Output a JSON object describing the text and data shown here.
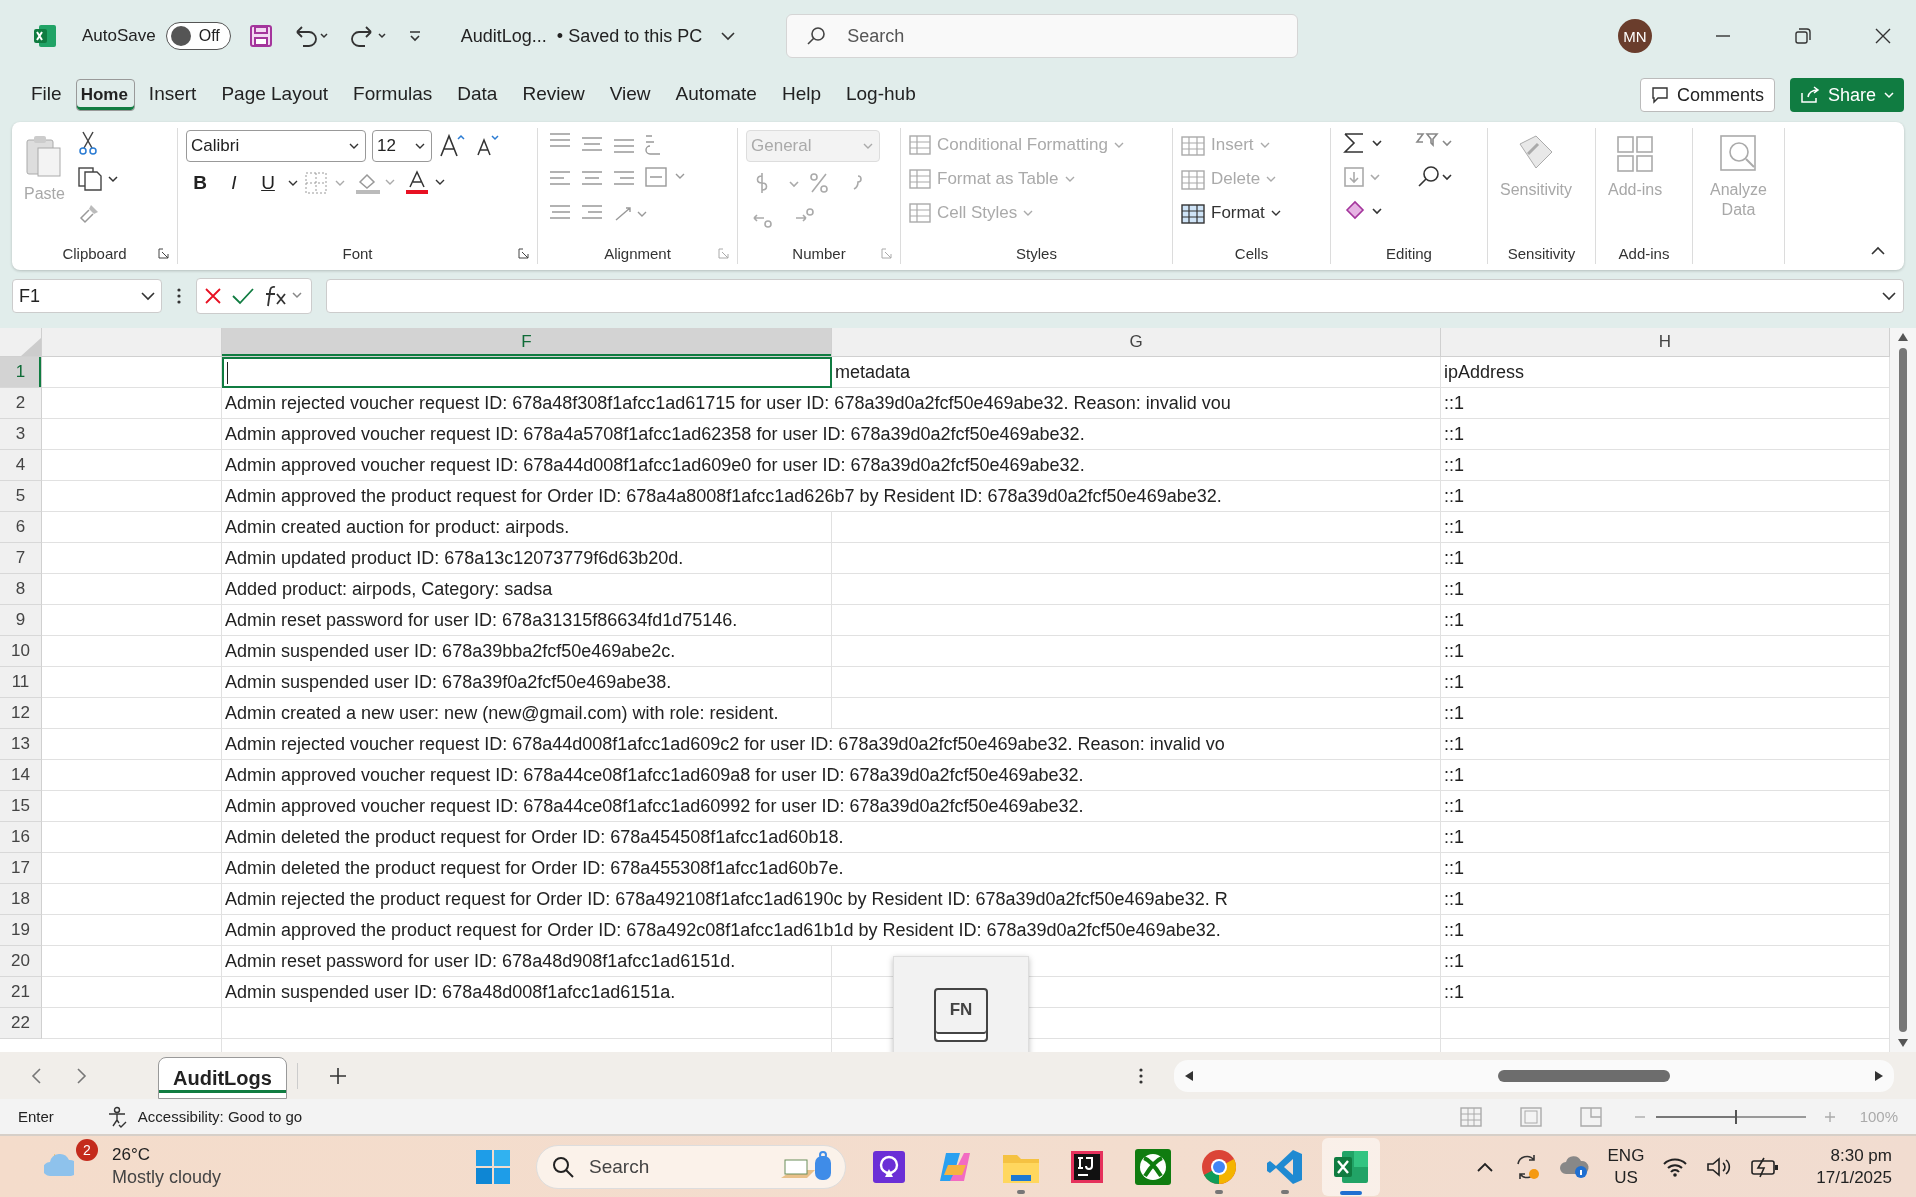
{
  "title_bar": {
    "autosave_label": "AutoSave",
    "autosave": {
      "on": false,
      "label": "Off"
    },
    "file_name": "AuditLog...",
    "save_status": "• Saved to this PC",
    "search_placeholder": "Search",
    "avatar": "MN"
  },
  "menu_tabs": [
    {
      "label": "File",
      "selected": false
    },
    {
      "label": "Home",
      "selected": true
    },
    {
      "label": "Insert",
      "selected": false
    },
    {
      "label": "Page Layout",
      "selected": false
    },
    {
      "label": "Formulas",
      "selected": false
    },
    {
      "label": "Data",
      "selected": false
    },
    {
      "label": "Review",
      "selected": false
    },
    {
      "label": "View",
      "selected": false
    },
    {
      "label": "Automate",
      "selected": false
    },
    {
      "label": "Help",
      "selected": false
    },
    {
      "label": "Log-hub",
      "selected": false
    }
  ],
  "comments_button": "Comments",
  "share_button": "Share",
  "ribbon": {
    "clipboard": {
      "label": "Clipboard",
      "paste": {
        "label": "Paste",
        "disabled": true
      }
    },
    "font": {
      "label": "Font",
      "family": "Calibri",
      "size": "12",
      "format_buttons": [
        "B",
        "I",
        "U"
      ]
    },
    "alignment": {
      "label": "Alignment"
    },
    "number": {
      "label": "Number",
      "format": {
        "value": "General",
        "disabled": true
      }
    },
    "styles": {
      "label": "Styles",
      "items": [
        {
          "label": "Conditional Formatting",
          "disabled": true
        },
        {
          "label": "Format as Table",
          "disabled": true
        },
        {
          "label": "Cell Styles",
          "disabled": true
        }
      ]
    },
    "cells": {
      "label": "Cells",
      "items": [
        {
          "label": "Insert",
          "disabled": true
        },
        {
          "label": "Delete",
          "disabled": true
        },
        {
          "label": "Format",
          "disabled": false
        }
      ]
    },
    "editing": {
      "label": "Editing"
    },
    "sensitivity": {
      "label": "Sensitivity",
      "button": {
        "label": "Sensitivity",
        "disabled": true
      }
    },
    "addins": {
      "label": "Add-ins",
      "button": {
        "label": "Add-ins",
        "disabled": true
      }
    },
    "analyze": {
      "label": "Analyze Data",
      "disabled": true
    }
  },
  "formula_bar": {
    "name_box": "F1"
  },
  "sheet": {
    "columns": [
      {
        "label": "F",
        "selected": true
      },
      {
        "label": "G",
        "selected": false
      },
      {
        "label": "H",
        "selected": false
      }
    ],
    "rows": [
      {
        "number": "1",
        "selected": true,
        "metadata": "metadata",
        "ip": "ipAddress"
      },
      {
        "number": "2",
        "selected": false,
        "message": "Admin rejected voucher request ID: 678a48f308f1afcc1ad61715 for user ID: 678a39d0a2fcf50e469abe32. Reason: invalid vou",
        "ip": "::1"
      },
      {
        "number": "3",
        "selected": false,
        "message": "Admin approved voucher request ID: 678a4a5708f1afcc1ad62358 for user ID: 678a39d0a2fcf50e469abe32.",
        "ip": "::1"
      },
      {
        "number": "4",
        "selected": false,
        "message": "Admin approved voucher request ID: 678a44d008f1afcc1ad609e0 for user ID: 678a39d0a2fcf50e469abe32.",
        "ip": "::1"
      },
      {
        "number": "5",
        "selected": false,
        "message": "Admin approved the product request for Order ID: 678a4a8008f1afcc1ad626b7 by Resident ID: 678a39d0a2fcf50e469abe32.",
        "ip": "::1"
      },
      {
        "number": "6",
        "selected": false,
        "message": "Admin created auction for product: airpods.",
        "ip": "::1"
      },
      {
        "number": "7",
        "selected": false,
        "message": "Admin updated product ID: 678a13c12073779f6d63b20d.",
        "ip": "::1"
      },
      {
        "number": "8",
        "selected": false,
        "message": "Added product: airpods, Category: sadsa",
        "ip": "::1"
      },
      {
        "number": "9",
        "selected": false,
        "message": "Admin reset password for user ID: 678a31315f86634fd1d75146.",
        "ip": "::1"
      },
      {
        "number": "10",
        "selected": false,
        "message": "Admin suspended user ID: 678a39bba2fcf50e469abe2c.",
        "ip": "::1"
      },
      {
        "number": "11",
        "selected": false,
        "message": "Admin suspended user ID: 678a39f0a2fcf50e469abe38.",
        "ip": "::1"
      },
      {
        "number": "12",
        "selected": false,
        "message": "Admin created a new user: new (new@gmail.com) with role: resident.",
        "ip": "::1"
      },
      {
        "number": "13",
        "selected": false,
        "message": "Admin rejected voucher request ID: 678a44d008f1afcc1ad609c2 for user ID: 678a39d0a2fcf50e469abe32. Reason: invalid vo",
        "ip": "::1"
      },
      {
        "number": "14",
        "selected": false,
        "message": "Admin approved voucher request ID: 678a44ce08f1afcc1ad609a8 for user ID: 678a39d0a2fcf50e469abe32.",
        "ip": "::1"
      },
      {
        "number": "15",
        "selected": false,
        "message": "Admin approved voucher request ID: 678a44ce08f1afcc1ad60992 for user ID: 678a39d0a2fcf50e469abe32.",
        "ip": "::1"
      },
      {
        "number": "16",
        "selected": false,
        "message": "Admin deleted the product request for Order ID: 678a454508f1afcc1ad60b18.",
        "ip": "::1"
      },
      {
        "number": "17",
        "selected": false,
        "message": "Admin deleted the product request for Order ID: 678a455308f1afcc1ad60b7e.",
        "ip": "::1"
      },
      {
        "number": "18",
        "selected": false,
        "message": "Admin rejected the product request for Order ID: 678a492108f1afcc1ad6190c by Resident ID: 678a39d0a2fcf50e469abe32. R",
        "ip": "::1"
      },
      {
        "number": "19",
        "selected": false,
        "message": "Admin approved the product request for Order ID: 678a492c08f1afcc1ad61b1d by Resident ID: 678a39d0a2fcf50e469abe32.",
        "ip": "::1"
      },
      {
        "number": "20",
        "selected": false,
        "message": "Admin reset password for user ID: 678a48d908f1afcc1ad6151d.",
        "ip": "::1"
      },
      {
        "number": "21",
        "selected": false,
        "message": "Admin suspended user ID: 678a48d008f1afcc1ad6151a.",
        "ip": "::1"
      },
      {
        "number": "22",
        "selected": false
      }
    ]
  },
  "fn_overlay": {
    "label": "FN"
  },
  "sheet_tabs": [
    {
      "label": "AuditLogs",
      "selected": true
    }
  ],
  "status_bar": {
    "mode": "Enter",
    "accessibility": "Accessibility: Good to go",
    "zoom_slider": {
      "level": 0.54
    },
    "zoom": "100%"
  },
  "taskbar": {
    "weather": {
      "temperature": "26°C",
      "condition": "Mostly cloudy",
      "badge": "2"
    },
    "search_placeholder": "Search",
    "apps": [
      {
        "kind": "start",
        "running": false,
        "active": false
      },
      {
        "kind": "podcast",
        "running": false,
        "active": false
      },
      {
        "kind": "copilot",
        "running": false,
        "active": false
      },
      {
        "kind": "files",
        "running": true,
        "active": false
      },
      {
        "kind": "intellij",
        "running": false,
        "active": false
      },
      {
        "kind": "xbox",
        "running": false,
        "active": false
      },
      {
        "kind": "chrome",
        "running": true,
        "active": false
      },
      {
        "kind": "vscode",
        "running": true,
        "active": false
      },
      {
        "kind": "excel",
        "running": true,
        "active": true
      }
    ],
    "language": "ENG",
    "region": "US",
    "time": "8:30 pm",
    "date": "17/1/2025"
  }
}
